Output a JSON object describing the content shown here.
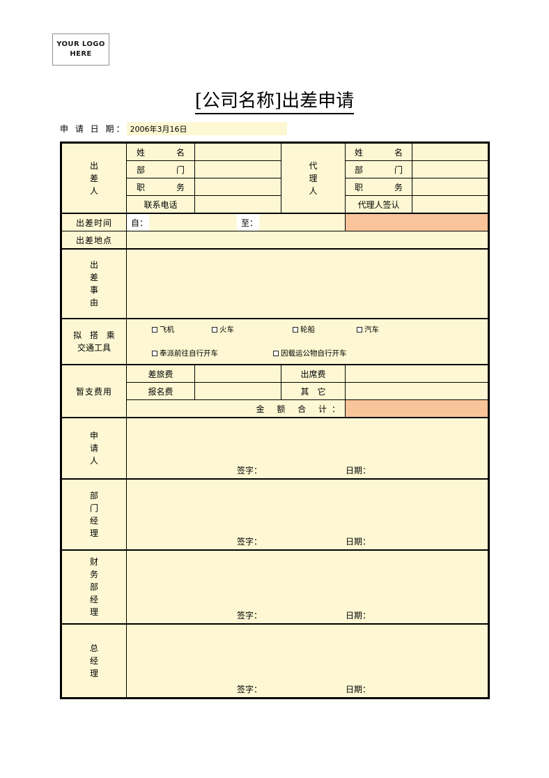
{
  "logo": {
    "line1": "YOUR LOGO",
    "line2": "HERE"
  },
  "title": "[公司名称]出差申请",
  "apply_date": {
    "label": "申 请 日 期：",
    "value": "2006年3月16日"
  },
  "traveler": {
    "section_label": "出差人",
    "fields": [
      {
        "label": "姓　　名",
        "value": ""
      },
      {
        "label": "部　　门",
        "value": ""
      },
      {
        "label": "职　　务",
        "value": ""
      },
      {
        "label": "联系电话",
        "value": ""
      }
    ]
  },
  "agent": {
    "section_label": "代理人",
    "fields": [
      {
        "label": "姓　　名",
        "value": ""
      },
      {
        "label": "部　　门",
        "value": ""
      },
      {
        "label": "职　　务",
        "value": ""
      },
      {
        "label": "代理人签认",
        "value": ""
      }
    ]
  },
  "travel_time": {
    "label": "出差时间",
    "from_label": "自：",
    "from_value": "",
    "to_label": "至：",
    "to_value": ""
  },
  "travel_place": {
    "label": "出差地点",
    "value": ""
  },
  "reason": {
    "label": "出差事由",
    "value": ""
  },
  "transport": {
    "label_line1": "拟 搭 乘",
    "label_line2": "交通工具",
    "options_row1": [
      "飞机",
      "火车",
      "轮船",
      "汽车"
    ],
    "options_row2": [
      "奉派前往自行开车",
      "因载运公物自行开车"
    ]
  },
  "expenses": {
    "label": "暂支费用",
    "rows": [
      {
        "left_label": "差旅费",
        "left_value": "",
        "right_label": "出席费",
        "right_value": ""
      },
      {
        "left_label": "报名费",
        "left_value": "",
        "right_label": "其　它",
        "right_value": ""
      }
    ],
    "total_label": "金 额 合 计：",
    "total_value": ""
  },
  "signatures": [
    {
      "role": "申请人",
      "sign_label": "签字：",
      "date_label": "日期：",
      "sign_value": "",
      "date_value": ""
    },
    {
      "role": "部门经理",
      "sign_label": "签字：",
      "date_label": "日期：",
      "sign_value": "",
      "date_value": ""
    },
    {
      "role": "财务部经理",
      "sign_label": "签字：",
      "date_label": "日期：",
      "sign_value": "",
      "date_value": ""
    },
    {
      "role": "总经理",
      "sign_label": "签字：",
      "date_label": "日期：",
      "sign_value": "",
      "date_value": ""
    }
  ],
  "colors": {
    "field_fill": "#fdf8d3",
    "highlight_fill": "#f9c49a",
    "border": "#000000",
    "page_bg": "#ffffff"
  }
}
